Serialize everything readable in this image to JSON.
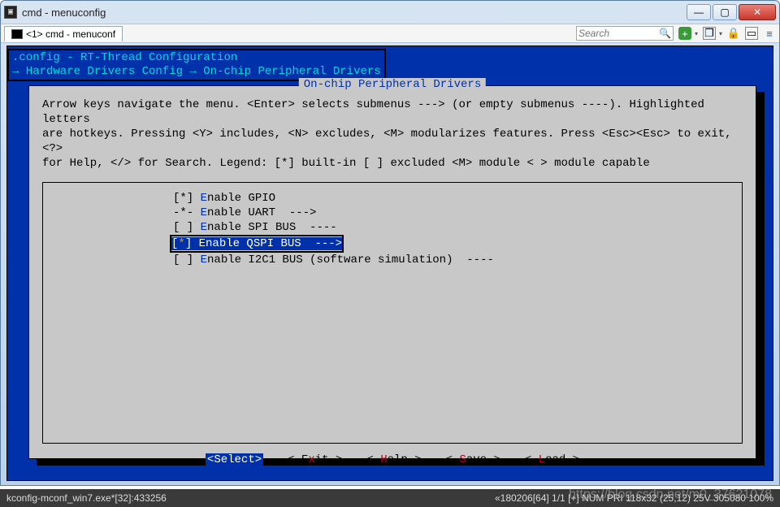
{
  "window": {
    "title": "cmd - menuconfig",
    "tab_label": "<1> cmd - menuconf",
    "search_placeholder": "Search"
  },
  "config": {
    "header_line1": ".config - RT-Thread Configuration",
    "header_line2": "→ Hardware Drivers Config → On-chip Peripheral Drivers",
    "panel_title": "On-chip Peripheral Drivers",
    "help1": "Arrow keys navigate the menu.  <Enter> selects submenus ---> (or empty submenus ----).  Highlighted letters",
    "help2": "are hotkeys.  Pressing <Y> includes, <N> excludes, <M> modularizes features.  Press <Esc><Esc> to exit, <?>",
    "help3": "for Help, </> for Search.  Legend: [*] built-in  [ ] excluded  <M> module  < > module capable"
  },
  "menu": {
    "items": [
      {
        "mark": "[*] ",
        "hk": "E",
        "rest": "nable GPIO"
      },
      {
        "mark": "-*- ",
        "hk": "E",
        "rest": "nable UART  --->"
      },
      {
        "mark": "[ ] ",
        "hk": "E",
        "rest": "nable SPI BUS  ----"
      },
      {
        "mark_prefix": "[",
        "mark_star": "*",
        "mark_suffix": "] ",
        "text": "Enable QSPI BUS  --->",
        "selected": true
      },
      {
        "mark": "[ ] ",
        "hk": "E",
        "rest": "nable I2C1 BUS (software simulation)  ----"
      }
    ]
  },
  "actions": {
    "select": "<Select>",
    "exit_l": "< E",
    "exit_h": "x",
    "exit_r": "it >",
    "help_l": "< ",
    "help_h": "H",
    "help_r": "elp >",
    "save_l": "< ",
    "save_h": "S",
    "save_r": "ave >",
    "load_l": "< ",
    "load_h": "L",
    "load_r": "oad >"
  },
  "status": {
    "left": "kconfig-mconf_win7.exe*[32]:433256",
    "r1": "«180206[64]  1/1  [+]  NUM  PRI   118x32  (25,12) 25V  305080 100%"
  },
  "watermark": "https://blog.csdn.net/m0_37621078"
}
